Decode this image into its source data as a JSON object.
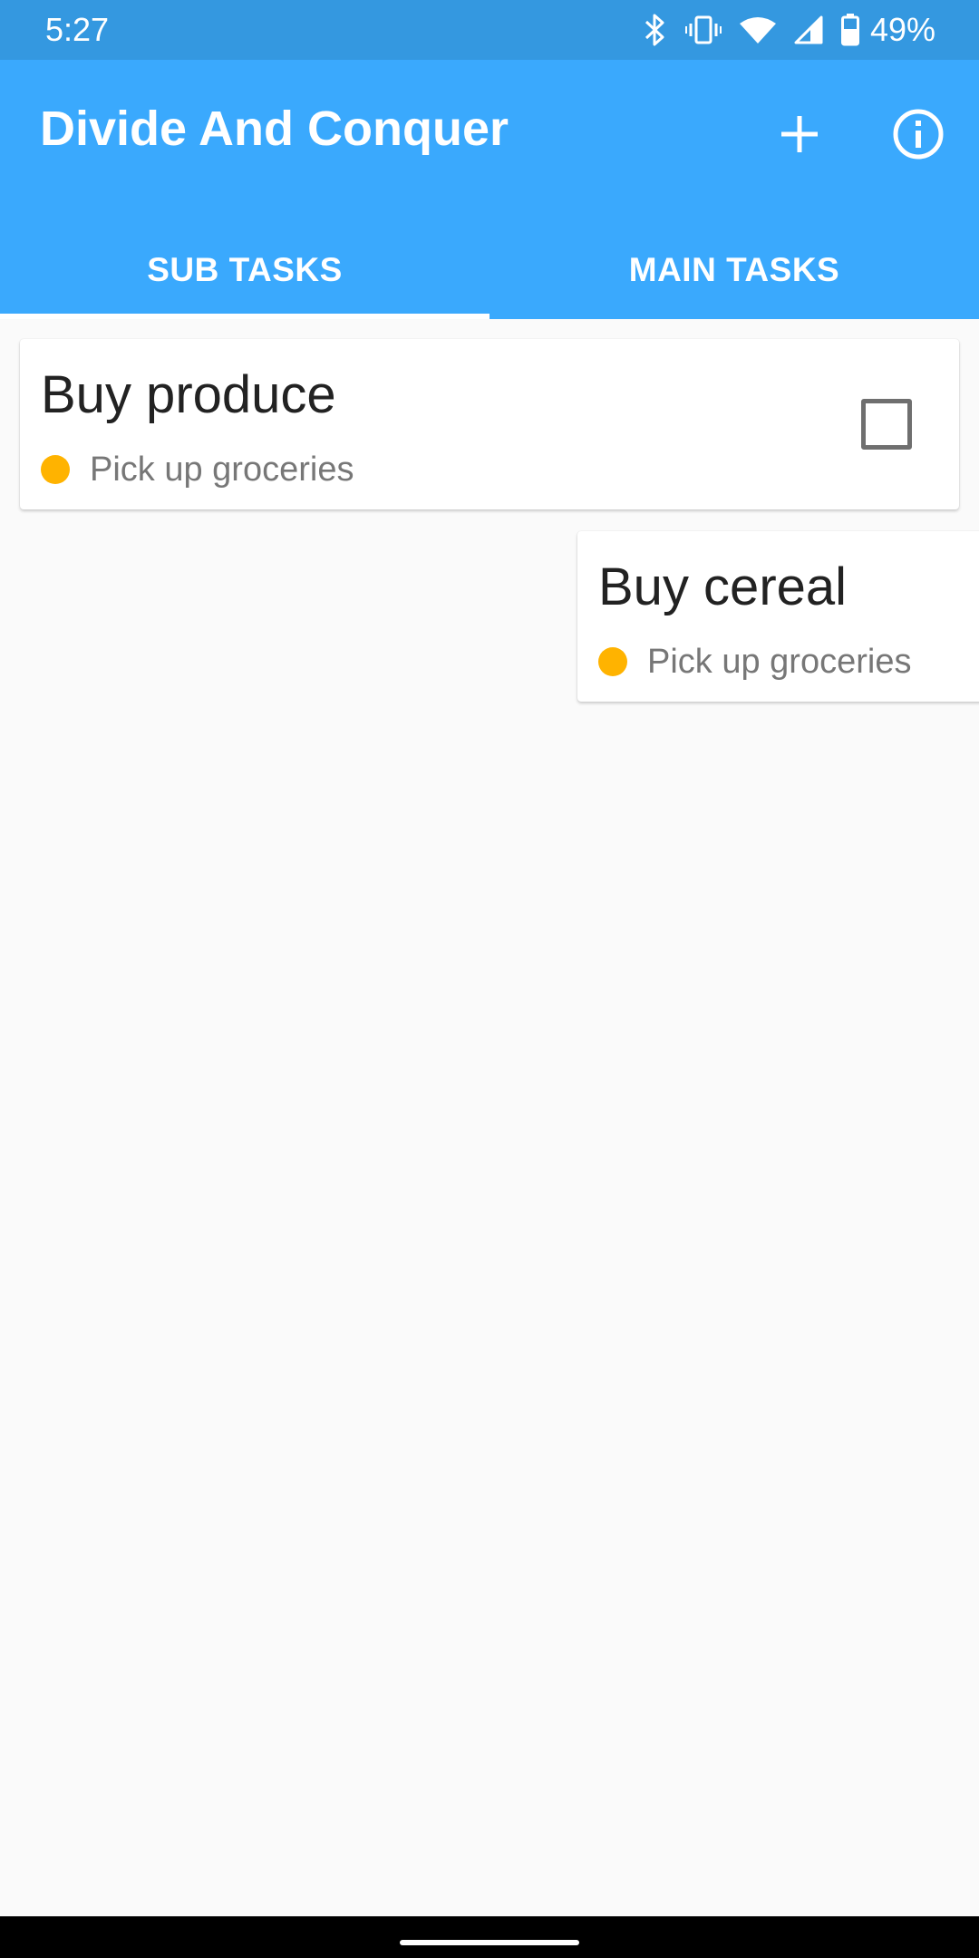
{
  "status_bar": {
    "time": "5:27",
    "battery_percent": "49%",
    "icons": [
      "bluetooth-icon",
      "vibrate-icon",
      "wifi-icon",
      "cell-signal-icon",
      "battery-icon"
    ]
  },
  "app_bar": {
    "title": "Divide And Conquer",
    "actions": [
      "add-icon",
      "info-icon"
    ]
  },
  "tabs": [
    {
      "label": "SUB TASKS",
      "selected": true
    },
    {
      "label": "MAIN TASKS",
      "selected": false
    }
  ],
  "tasks": [
    {
      "title": "Buy produce",
      "main_task": "Pick up groceries",
      "checked": false
    },
    {
      "title": "Buy cereal",
      "main_task": "Pick up groceries",
      "checked": false
    }
  ],
  "colors": {
    "status_bar": "#3498e0",
    "app_bar": "#3aa9fd",
    "background": "#fafafa",
    "task_dot": "#ffb300"
  }
}
